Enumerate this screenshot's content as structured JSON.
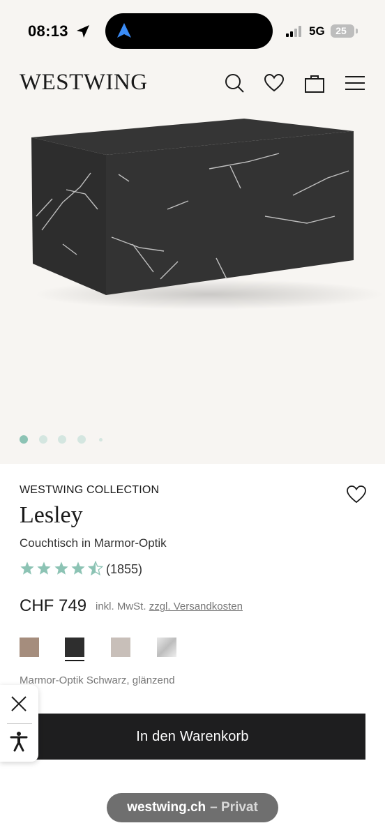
{
  "status_bar": {
    "time": "08:13",
    "network": "5G",
    "battery": "25"
  },
  "header": {
    "logo": "WESTWING",
    "icons": [
      "search-icon",
      "heart-icon",
      "shopping-bag-icon",
      "menu-icon"
    ]
  },
  "gallery": {
    "image": "black marble-look block coffee table",
    "active_index": 0,
    "dot_count": 5
  },
  "product": {
    "brand": "WESTWING COLLECTION",
    "name": "Lesley",
    "subtitle": "Couchtisch in Marmor-Optik",
    "rating": 4.5,
    "rating_count": "(1855)",
    "price": "CHF 749",
    "tax_note": "inkl. MwSt.",
    "shipping_link": "zzgl. Versandkosten",
    "swatches": [
      {
        "name": "taupe",
        "color": "#a58d7d"
      },
      {
        "name": "black",
        "color": "#2e2e2e",
        "selected": true
      },
      {
        "name": "greige",
        "color": "#c8bfb9"
      },
      {
        "name": "silver",
        "color": "#cfcfcf"
      }
    ],
    "variant_label": "Marmor-Optik Schwarz, glänzend",
    "add_to_cart": "In den Warenkorb"
  },
  "colors": {
    "accent": "#8cc3b4",
    "button": "#1e1e1f",
    "background": "#f7f5f2"
  },
  "browser": {
    "domain": "westwing.ch",
    "mode": "– Privat"
  }
}
